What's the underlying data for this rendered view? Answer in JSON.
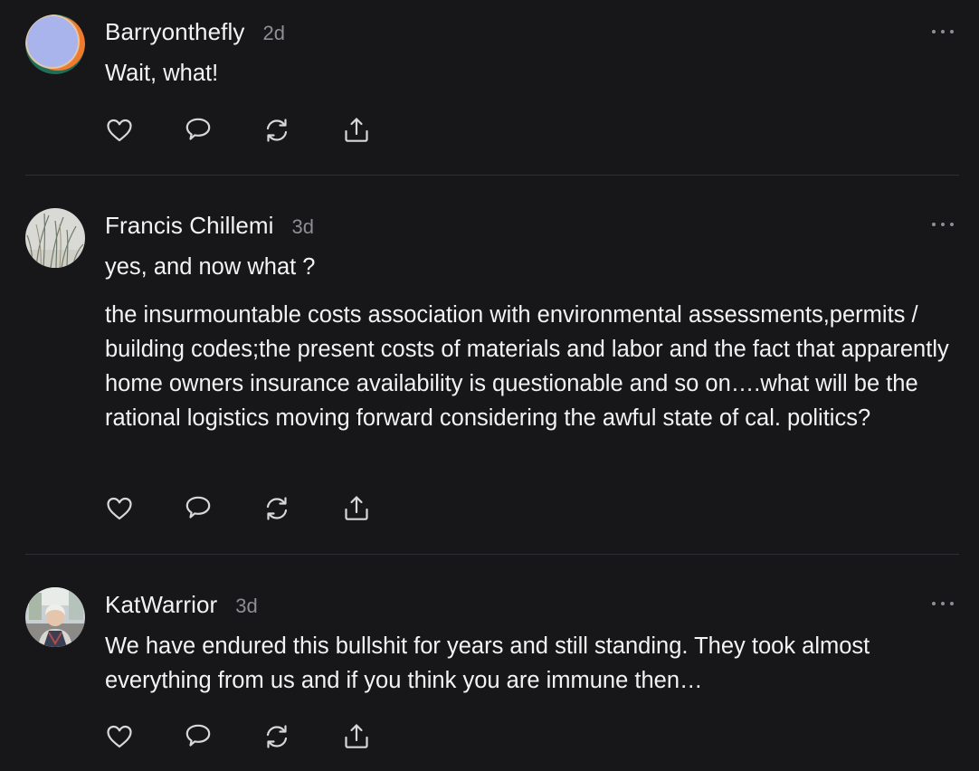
{
  "comments": [
    {
      "username": "Barryonthefly",
      "timestamp": "2d",
      "paragraphs": [
        "Wait, what!"
      ],
      "avatar_icon": "gradient-circle-avatar"
    },
    {
      "username": "Francis Chillemi",
      "timestamp": "3d",
      "paragraphs": [
        "yes, and now what ?",
        "the insurmountable costs association with environmental assessments,permits / building codes;the present costs of materials and labor and the fact that apparently home owners insurance availability is questionable and so on….what will be the rational logistics moving forward considering the awful state of cal. politics?"
      ],
      "avatar_icon": "grass-photo-avatar"
    },
    {
      "username": "KatWarrior",
      "timestamp": "3d",
      "paragraphs": [
        "We have endured this bullshit for years and still standing. They took almost everything from us and if you think you are immune then…"
      ],
      "avatar_icon": "person-photo-avatar"
    }
  ],
  "action_icons": [
    "heart-icon",
    "comment-icon",
    "restack-icon",
    "share-icon"
  ],
  "colors": {
    "background": "#17171a",
    "text": "#f3f3f3",
    "muted": "#8e8e93",
    "divider": "#2f2f33"
  }
}
